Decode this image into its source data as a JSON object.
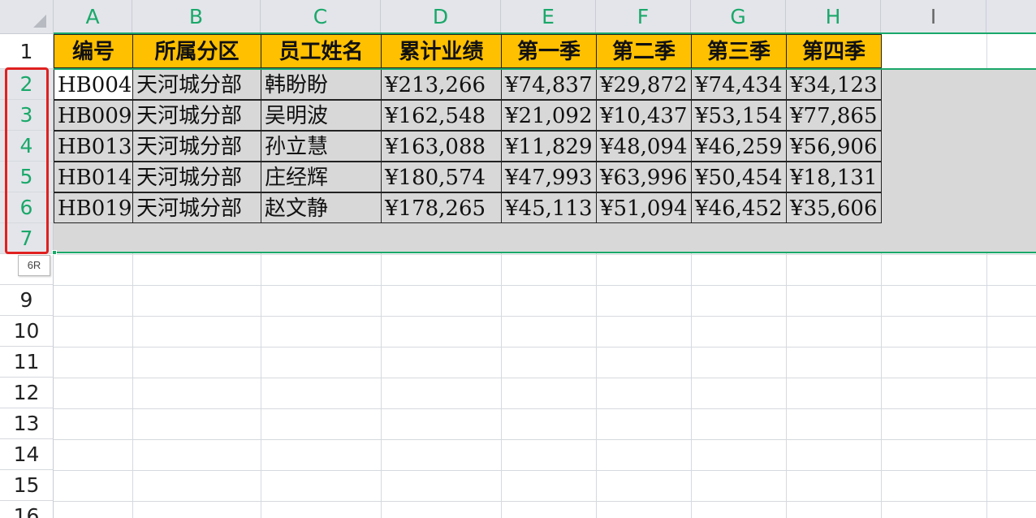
{
  "columns": [
    "A",
    "B",
    "C",
    "D",
    "E",
    "F",
    "G",
    "H",
    "I"
  ],
  "row_numbers": [
    "1",
    "2",
    "3",
    "4",
    "5",
    "6",
    "7",
    "9",
    "10",
    "11",
    "12",
    "13",
    "14",
    "15",
    "16"
  ],
  "table": {
    "headers": [
      "编号",
      "所属分区",
      "员工姓名",
      "累计业绩",
      "第一季",
      "第二季",
      "第三季",
      "第四季"
    ],
    "rows": [
      [
        "HB004",
        "天河城分部",
        "韩盼盼",
        "¥213,266",
        "¥74,837",
        "¥29,872",
        "¥74,434",
        "¥34,123"
      ],
      [
        "HB009",
        "天河城分部",
        "吴明波",
        "¥162,548",
        "¥21,092",
        "¥10,437",
        "¥53,154",
        "¥77,865"
      ],
      [
        "HB013",
        "天河城分部",
        "孙立慧",
        "¥163,088",
        "¥11,829",
        "¥48,094",
        "¥46,259",
        "¥56,906"
      ],
      [
        "HB014",
        "天河城分部",
        "庄经辉",
        "¥180,574",
        "¥47,993",
        "¥63,996",
        "¥50,454",
        "¥18,131"
      ],
      [
        "HB019",
        "天河城分部",
        "赵文静",
        "¥178,265",
        "¥45,113",
        "¥51,094",
        "¥46,452",
        "¥35,606"
      ]
    ]
  },
  "selection_tooltip": "6R",
  "colors": {
    "header_fill": "#ffc000",
    "selection_green": "#1aa86a",
    "highlight_box": "#e02020",
    "selection_shade": "#d8d8d8"
  }
}
